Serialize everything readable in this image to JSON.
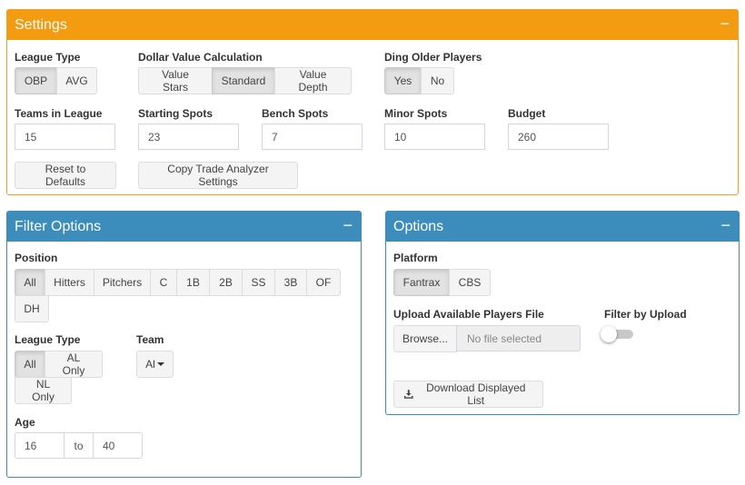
{
  "settings": {
    "title": "Settings",
    "collapse": "−",
    "league_type": {
      "label": "League Type",
      "options": [
        "OBP",
        "AVG"
      ],
      "active": "OBP"
    },
    "dollar_value": {
      "label": "Dollar Value Calculation",
      "options": [
        "Value Stars",
        "Standard",
        "Value Depth"
      ],
      "active": "Standard"
    },
    "ding_older": {
      "label": "Ding Older Players",
      "options": [
        "Yes",
        "No"
      ],
      "active": "Yes"
    },
    "teams": {
      "label": "Teams in League",
      "value": "15"
    },
    "starting": {
      "label": "Starting Spots",
      "value": "23"
    },
    "bench": {
      "label": "Bench Spots",
      "value": "7"
    },
    "minor": {
      "label": "Minor Spots",
      "value": "10"
    },
    "budget": {
      "label": "Budget",
      "value": "260"
    },
    "reset_label": "Reset to Defaults",
    "copy_label": "Copy Trade Analyzer Settings"
  },
  "filter": {
    "title": "Filter Options",
    "collapse": "−",
    "position": {
      "label": "Position",
      "options": [
        "All",
        "Hitters",
        "Pitchers",
        "C",
        "1B",
        "2B",
        "SS",
        "3B",
        "OF",
        "DH"
      ],
      "active": "All"
    },
    "league_type": {
      "label": "League Type",
      "options": [
        "All",
        "AL Only",
        "NL Only"
      ],
      "active": "All"
    },
    "team": {
      "label": "Team",
      "value": "Al"
    },
    "age": {
      "label": "Age",
      "from": "16",
      "to_label": "to",
      "to": "40"
    }
  },
  "options": {
    "title": "Options",
    "collapse": "−",
    "platform": {
      "label": "Platform",
      "options": [
        "Fantrax",
        "CBS"
      ],
      "active": "Fantrax"
    },
    "upload": {
      "label": "Upload Available Players File",
      "browse_label": "Browse...",
      "placeholder": "No file selected"
    },
    "filter_upload": {
      "label": "Filter by Upload",
      "enabled": false
    },
    "download_label": "Download Displayed List"
  }
}
